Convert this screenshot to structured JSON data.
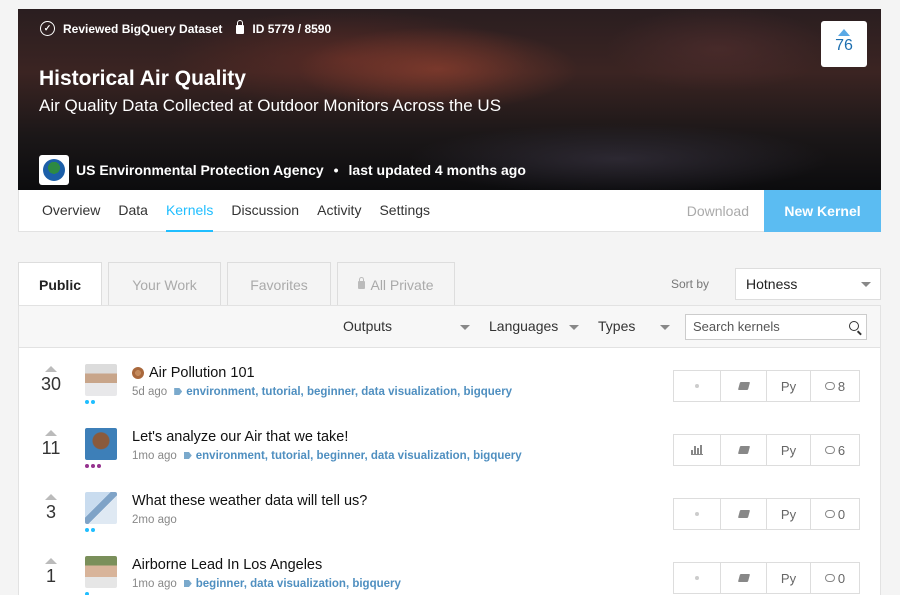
{
  "dataset": {
    "badge_reviewed": "Reviewed BigQuery Dataset",
    "badge_id": "ID 5779 / 8590",
    "title": "Historical Air Quality",
    "subtitle": "Air Quality Data Collected at Outdoor Monitors Across the US",
    "owner": "US Environmental Protection Agency",
    "separator": "•",
    "updated": "last updated 4 months ago",
    "votes": "76"
  },
  "nav": {
    "tabs": [
      "Overview",
      "Data",
      "Kernels",
      "Discussion",
      "Activity",
      "Settings"
    ],
    "active_tab": "Kernels",
    "download": "Download",
    "new_kernel": "New Kernel"
  },
  "kernels_tabs": {
    "public": "Public",
    "your_work": "Your Work",
    "favorites": "Favorites",
    "all_private": "All Private"
  },
  "sort": {
    "label": "Sort by",
    "value": "Hotness"
  },
  "filters": {
    "outputs": "Outputs",
    "languages": "Languages",
    "types": "Types",
    "search_placeholder": "Search kernels"
  },
  "kernels": [
    {
      "votes": "30",
      "title": "Air Pollution 101",
      "medal": true,
      "age": "5d ago",
      "tags": "environment, tutorial, beginner, data visualization, bigquery",
      "output_icon": "dot",
      "language": "Py",
      "comments": "8",
      "tier_color": "#20beff",
      "tier_dots": 2
    },
    {
      "votes": "11",
      "title": "Let's analyze our Air that we take!",
      "medal": false,
      "age": "1mo ago",
      "tags": "environment, tutorial, beginner, data visualization, bigquery",
      "output_icon": "bar-chart",
      "language": "Py",
      "comments": "6",
      "tier_color": "#96338f",
      "tier_dots": 3
    },
    {
      "votes": "3",
      "title": "What these weather data will tell us?",
      "medal": false,
      "age": "2mo ago",
      "tags": "",
      "output_icon": "dot",
      "language": "Py",
      "comments": "0",
      "tier_color": "#20beff",
      "tier_dots": 2
    },
    {
      "votes": "1",
      "title": "Airborne Lead In Los Angeles",
      "medal": false,
      "age": "1mo ago",
      "tags": "beginner, data visualization, bigquery",
      "output_icon": "dot",
      "language": "Py",
      "comments": "0",
      "tier_color": "#20beff",
      "tier_dots": 1
    }
  ],
  "colors": {
    "accent": "#20beff",
    "new_kernel_bg": "#5bbcf2",
    "tag": "#4f8fc0"
  },
  "icons": [
    "check-circle-icon",
    "lock-icon",
    "epa-logo",
    "search-icon",
    "tag-icon",
    "medal-icon",
    "notebook-icon",
    "comment-icon",
    "chevron-down-icon"
  ]
}
